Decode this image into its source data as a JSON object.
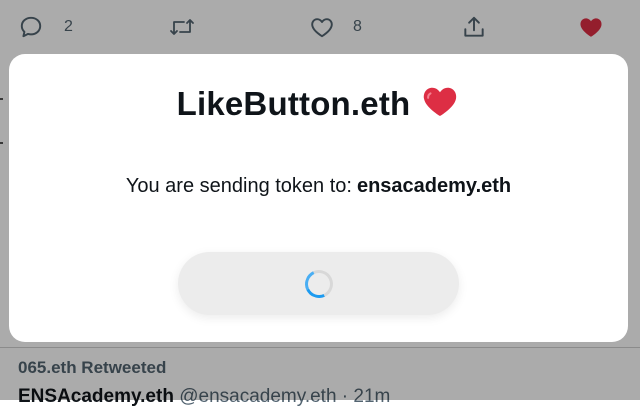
{
  "background_tweet": {
    "actions": {
      "reply_count": "2",
      "like_count": "8"
    },
    "retweet_label": "065.eth Retweeted",
    "author_name": "ENSAcademy.eth",
    "author_meta": "@ensacademy.eth · 21m"
  },
  "modal": {
    "title": "LikeButton.eth",
    "title_emoji_icon": "red-heart-icon",
    "message_prefix": "You are sending token to:",
    "recipient": "ensacademy.eth",
    "button_state": "loading",
    "spinner_icon": "loading-spinner-icon"
  },
  "colors": {
    "heart_red": "#e0245e",
    "spinner_blue": "#1d9bf0",
    "muted_text": "#536471"
  }
}
